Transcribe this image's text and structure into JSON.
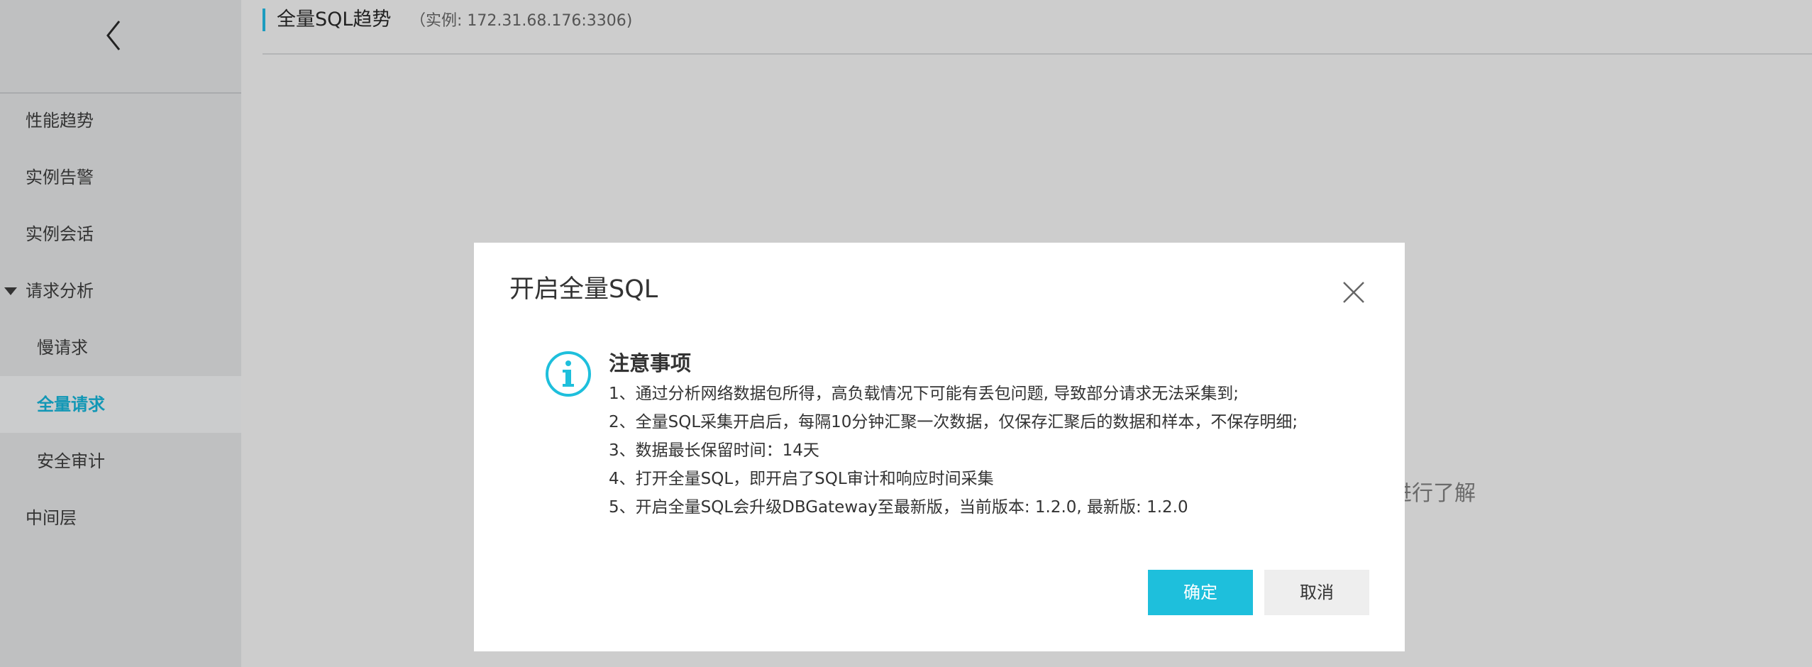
{
  "sidebar": {
    "back_icon": "chevron-left-icon",
    "items": [
      {
        "label": "性能趋势"
      },
      {
        "label": "实例告警"
      },
      {
        "label": "实例会话"
      },
      {
        "label": "请求分析",
        "expanded": true
      },
      {
        "label": "慢请求"
      },
      {
        "label": "全量请求",
        "active": true
      },
      {
        "label": "安全审计"
      },
      {
        "label": "中间层"
      }
    ]
  },
  "header": {
    "title": "全量SQL趋势",
    "subtitle": "（实例: 172.31.68.176:3306)"
  },
  "background": {
    "hint_text": "进行了解"
  },
  "modal": {
    "title": "开启全量SQL",
    "close_icon": "close-icon",
    "info_icon": "info-circle-icon",
    "notice_title": "注意事项",
    "notices": [
      "1、通过分析网络数据包所得，高负载情况下可能有丢包问题, 导致部分请求无法采集到;",
      "2、全量SQL采集开启后，每隔10分钟汇聚一次数据，仅保存汇聚后的数据和样本，不保存明细;",
      "3、数据最长保留时间：14天",
      "4、打开全量SQL，即开启了SQL审计和响应时间采集",
      "5、开启全量SQL会升级DBGateway至最新版，当前版本: 1.2.0, 最新版: 1.2.0"
    ],
    "ok_label": "确定",
    "cancel_label": "取消"
  },
  "colors": {
    "accent": "#1ebfdc",
    "active_nav_text": "#1297b5",
    "sidebar_bg": "#bfc0c1",
    "overlay_bg": "#cdcdcd"
  }
}
